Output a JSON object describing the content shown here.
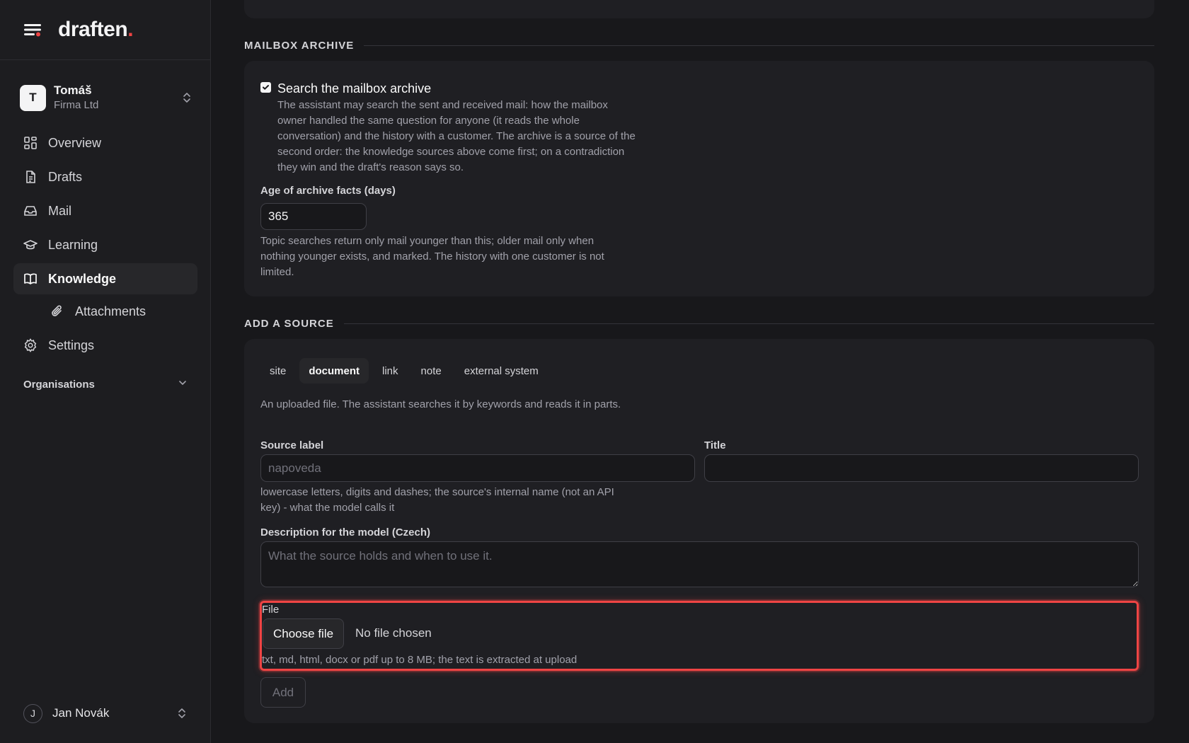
{
  "app": {
    "brand": "draften",
    "brand_dot": "."
  },
  "org": {
    "avatar": "T",
    "name": "Tomáš",
    "company": "Firma Ltd"
  },
  "nav": {
    "overview": "Overview",
    "drafts": "Drafts",
    "mail": "Mail",
    "learning": "Learning",
    "knowledge": "Knowledge",
    "attachments": "Attachments",
    "settings": "Settings"
  },
  "organisations_label": "Organisations",
  "user": {
    "avatar": "J",
    "name": "Jan Novák"
  },
  "mailbox_archive": {
    "header": "MAILBOX ARCHIVE",
    "checkbox_label": "Search the mailbox archive",
    "checked": true,
    "description": "The assistant may search the sent and received mail: how the mailbox owner handled the same question for anyone (it reads the whole conversation) and the history with a customer. The archive is a source of the second order: the knowledge sources above come first; on a contradiction they win and the draft's reason says so.",
    "age_label": "Age of archive facts (days)",
    "age_value": "365",
    "age_help": "Topic searches return only mail younger than this; older mail only when nothing younger exists, and marked. The history with one customer is not limited."
  },
  "add_source": {
    "header": "ADD A SOURCE",
    "tabs": [
      "site",
      "document",
      "link",
      "note",
      "external system"
    ],
    "active_tab": "document",
    "tab_description": "An uploaded file. The assistant searches it by keywords and reads it in parts.",
    "source_label": "Source label",
    "source_placeholder": "napoveda",
    "source_help": "lowercase letters, digits and dashes; the source's internal name (not an API key) - what the model calls it",
    "title_label": "Title",
    "title_value": "",
    "description_label": "Description for the model (Czech)",
    "description_placeholder": "What the source holds and when to use it.",
    "file_label": "File",
    "choose_file": "Choose file",
    "no_file": "No file chosen",
    "file_help": "txt, md, html, docx or pdf up to 8 MB; the text is extracted at upload",
    "add_button": "Add"
  },
  "colors": {
    "accent": "#ef4444",
    "background": "#18181b",
    "card": "#1f1f23"
  }
}
